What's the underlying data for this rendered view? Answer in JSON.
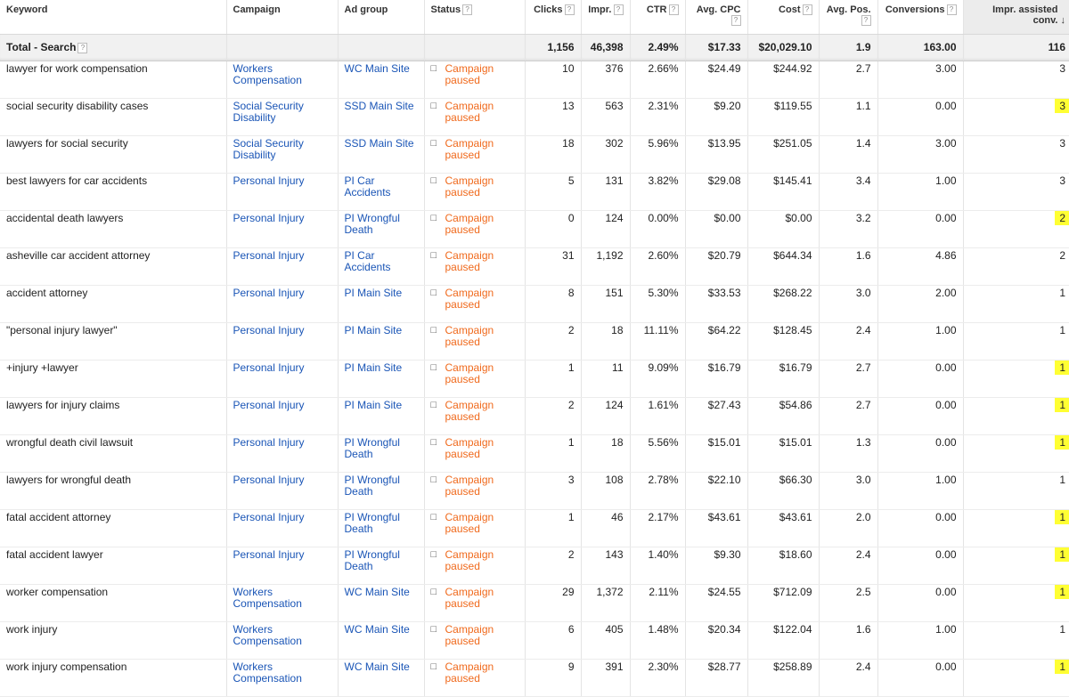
{
  "headers": {
    "keyword": "Keyword",
    "campaign": "Campaign",
    "ad_group": "Ad group",
    "status": "Status",
    "clicks": "Clicks",
    "impr": "Impr.",
    "ctr": "CTR",
    "avg_cpc": "Avg. CPC",
    "cost": "Cost",
    "avg_pos": "Avg. Pos.",
    "conversions": "Conversions",
    "impr_assisted": "Impr. assisted conv."
  },
  "help_icon": "?",
  "sort_icon": "arrow-down",
  "total": {
    "label": "Total - Search",
    "clicks": "1,156",
    "impr": "46,398",
    "ctr": "2.49%",
    "avg_cpc": "$17.33",
    "cost": "$20,029.10",
    "avg_pos": "1.9",
    "conversions": "163.00",
    "impr_assisted": "116"
  },
  "highlight_color": "#ffff33",
  "link_color": "#1a55b6",
  "status_color": "#f06a1d",
  "rows": [
    {
      "keyword": "lawyer for work compensation",
      "campaign": "Workers Compensation",
      "ad_group": "WC Main Site",
      "status": "Campaign paused",
      "clicks": "10",
      "impr": "376",
      "ctr": "2.66%",
      "avg_cpc": "$24.49",
      "cost": "$244.92",
      "avg_pos": "2.7",
      "conversions": "3.00",
      "impr_assisted": "3",
      "highlight": false
    },
    {
      "keyword": "social security disability cases",
      "campaign": "Social Security Disability",
      "ad_group": "SSD Main Site",
      "status": "Campaign paused",
      "clicks": "13",
      "impr": "563",
      "ctr": "2.31%",
      "avg_cpc": "$9.20",
      "cost": "$119.55",
      "avg_pos": "1.1",
      "conversions": "0.00",
      "impr_assisted": "3",
      "highlight": true
    },
    {
      "keyword": "lawyers for social security",
      "campaign": "Social Security Disability",
      "ad_group": "SSD Main Site",
      "status": "Campaign paused",
      "clicks": "18",
      "impr": "302",
      "ctr": "5.96%",
      "avg_cpc": "$13.95",
      "cost": "$251.05",
      "avg_pos": "1.4",
      "conversions": "3.00",
      "impr_assisted": "3",
      "highlight": false
    },
    {
      "keyword": "best lawyers for car accidents",
      "campaign": "Personal Injury",
      "ad_group": "PI Car Accidents",
      "status": "Campaign paused",
      "clicks": "5",
      "impr": "131",
      "ctr": "3.82%",
      "avg_cpc": "$29.08",
      "cost": "$145.41",
      "avg_pos": "3.4",
      "conversions": "1.00",
      "impr_assisted": "3",
      "highlight": false
    },
    {
      "keyword": "accidental death lawyers",
      "campaign": "Personal Injury",
      "ad_group": "PI Wrongful Death",
      "status": "Campaign paused",
      "clicks": "0",
      "impr": "124",
      "ctr": "0.00%",
      "avg_cpc": "$0.00",
      "cost": "$0.00",
      "avg_pos": "3.2",
      "conversions": "0.00",
      "impr_assisted": "2",
      "highlight": true
    },
    {
      "keyword": "asheville car accident attorney",
      "campaign": "Personal Injury",
      "ad_group": "PI Car Accidents",
      "status": "Campaign paused",
      "clicks": "31",
      "impr": "1,192",
      "ctr": "2.60%",
      "avg_cpc": "$20.79",
      "cost": "$644.34",
      "avg_pos": "1.6",
      "conversions": "4.86",
      "impr_assisted": "2",
      "highlight": false
    },
    {
      "keyword": "accident attorney",
      "campaign": "Personal Injury",
      "ad_group": "PI Main Site",
      "status": "Campaign paused",
      "clicks": "8",
      "impr": "151",
      "ctr": "5.30%",
      "avg_cpc": "$33.53",
      "cost": "$268.22",
      "avg_pos": "3.0",
      "conversions": "2.00",
      "impr_assisted": "1",
      "highlight": false
    },
    {
      "keyword": "\"personal injury lawyer\"",
      "campaign": "Personal Injury",
      "ad_group": "PI Main Site",
      "status": "Campaign paused",
      "clicks": "2",
      "impr": "18",
      "ctr": "11.11%",
      "avg_cpc": "$64.22",
      "cost": "$128.45",
      "avg_pos": "2.4",
      "conversions": "1.00",
      "impr_assisted": "1",
      "highlight": false
    },
    {
      "keyword": "+injury +lawyer",
      "campaign": "Personal Injury",
      "ad_group": "PI Main Site",
      "status": "Campaign paused",
      "clicks": "1",
      "impr": "11",
      "ctr": "9.09%",
      "avg_cpc": "$16.79",
      "cost": "$16.79",
      "avg_pos": "2.7",
      "conversions": "0.00",
      "impr_assisted": "1",
      "highlight": true
    },
    {
      "keyword": "lawyers for injury claims",
      "campaign": "Personal Injury",
      "ad_group": "PI Main Site",
      "status": "Campaign paused",
      "clicks": "2",
      "impr": "124",
      "ctr": "1.61%",
      "avg_cpc": "$27.43",
      "cost": "$54.86",
      "avg_pos": "2.7",
      "conversions": "0.00",
      "impr_assisted": "1",
      "highlight": true
    },
    {
      "keyword": "wrongful death civil lawsuit",
      "campaign": "Personal Injury",
      "ad_group": "PI Wrongful Death",
      "status": "Campaign paused",
      "clicks": "1",
      "impr": "18",
      "ctr": "5.56%",
      "avg_cpc": "$15.01",
      "cost": "$15.01",
      "avg_pos": "1.3",
      "conversions": "0.00",
      "impr_assisted": "1",
      "highlight": true
    },
    {
      "keyword": "lawyers for wrongful death",
      "campaign": "Personal Injury",
      "ad_group": "PI Wrongful Death",
      "status": "Campaign paused",
      "clicks": "3",
      "impr": "108",
      "ctr": "2.78%",
      "avg_cpc": "$22.10",
      "cost": "$66.30",
      "avg_pos": "3.0",
      "conversions": "1.00",
      "impr_assisted": "1",
      "highlight": false
    },
    {
      "keyword": "fatal accident attorney",
      "campaign": "Personal Injury",
      "ad_group": "PI Wrongful Death",
      "status": "Campaign paused",
      "clicks": "1",
      "impr": "46",
      "ctr": "2.17%",
      "avg_cpc": "$43.61",
      "cost": "$43.61",
      "avg_pos": "2.0",
      "conversions": "0.00",
      "impr_assisted": "1",
      "highlight": true
    },
    {
      "keyword": "fatal accident lawyer",
      "campaign": "Personal Injury",
      "ad_group": "PI Wrongful Death",
      "status": "Campaign paused",
      "clicks": "2",
      "impr": "143",
      "ctr": "1.40%",
      "avg_cpc": "$9.30",
      "cost": "$18.60",
      "avg_pos": "2.4",
      "conversions": "0.00",
      "impr_assisted": "1",
      "highlight": true
    },
    {
      "keyword": "worker compensation",
      "campaign": "Workers Compensation",
      "ad_group": "WC Main Site",
      "status": "Campaign paused",
      "clicks": "29",
      "impr": "1,372",
      "ctr": "2.11%",
      "avg_cpc": "$24.55",
      "cost": "$712.09",
      "avg_pos": "2.5",
      "conversions": "0.00",
      "impr_assisted": "1",
      "highlight": true
    },
    {
      "keyword": "work injury",
      "campaign": "Workers Compensation",
      "ad_group": "WC Main Site",
      "status": "Campaign paused",
      "clicks": "6",
      "impr": "405",
      "ctr": "1.48%",
      "avg_cpc": "$20.34",
      "cost": "$122.04",
      "avg_pos": "1.6",
      "conversions": "1.00",
      "impr_assisted": "1",
      "highlight": false
    },
    {
      "keyword": "work injury compensation",
      "campaign": "Workers Compensation",
      "ad_group": "WC Main Site",
      "status": "Campaign paused",
      "clicks": "9",
      "impr": "391",
      "ctr": "2.30%",
      "avg_cpc": "$28.77",
      "cost": "$258.89",
      "avg_pos": "2.4",
      "conversions": "0.00",
      "impr_assisted": "1",
      "highlight": true
    }
  ]
}
